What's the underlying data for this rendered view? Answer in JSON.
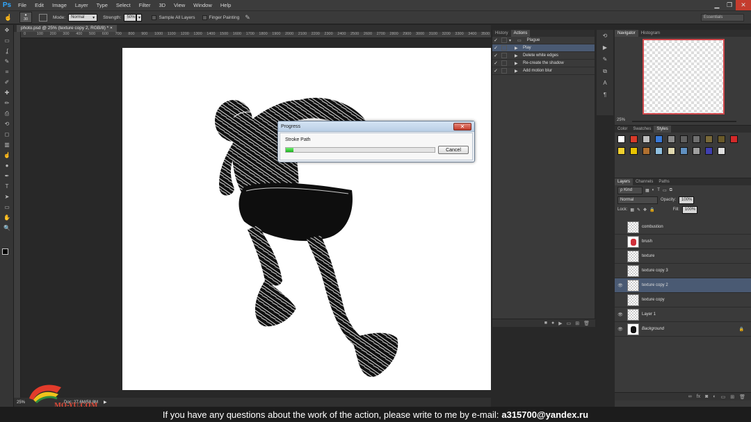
{
  "app": {
    "logo": "Ps",
    "workspace": "Essentials"
  },
  "menu": [
    "File",
    "Edit",
    "Image",
    "Layer",
    "Type",
    "Select",
    "Filter",
    "3D",
    "View",
    "Window",
    "Help"
  ],
  "options": {
    "brush_size": "30",
    "mode_label": "Mode:",
    "mode_value": "Normal",
    "strength_label": "Strength:",
    "strength_value": "50%",
    "sample_all_layers": "Sample All Layers",
    "finger_painting": "Finger Painting"
  },
  "document": {
    "tab_title": "photo.psd @ 25% (texture copy 2, RGB/8) *",
    "ruler_ticks": [
      "0",
      "100",
      "200",
      "300",
      "400",
      "500",
      "600",
      "700",
      "800",
      "900",
      "1000",
      "1100",
      "1200",
      "1300",
      "1400",
      "1500",
      "1600",
      "1700",
      "1800",
      "1900",
      "2000",
      "2100",
      "2200",
      "2300",
      "2400",
      "2500",
      "2600",
      "2700",
      "2800",
      "2900",
      "3000",
      "3100",
      "3200",
      "3300",
      "3400",
      "3500",
      "3600"
    ]
  },
  "status": {
    "zoom": "25%",
    "doc_size": "Doc: 27.6M/58.8M"
  },
  "progress_dialog": {
    "title": "Progress",
    "message": "Stroke Path",
    "progress": 0.05,
    "cancel_label": "Cancel"
  },
  "actions_panel": {
    "tabs": [
      "History",
      "Actions"
    ],
    "rows": [
      {
        "label": "Plague",
        "checked": true,
        "folder": true,
        "selected": false
      },
      {
        "label": "Play",
        "checked": true,
        "folder": false,
        "selected": true
      },
      {
        "label": "Delete white edges",
        "checked": true,
        "folder": false,
        "selected": false
      },
      {
        "label": "Re-create the shadow",
        "checked": true,
        "folder": false,
        "selected": false
      },
      {
        "label": "Add motion blur",
        "checked": true,
        "folder": false,
        "selected": false
      }
    ]
  },
  "navigator": {
    "tabs": [
      "Navigator",
      "Histogram"
    ],
    "zoom": "25%"
  },
  "styles_panel": {
    "tabs": [
      "Color",
      "Swatches",
      "Styles"
    ]
  },
  "layers_panel": {
    "tabs": [
      "Layers",
      "Channels",
      "Paths"
    ],
    "kind_label": "ρ Kind",
    "blend_mode": "Normal",
    "opacity_label": "Opacity:",
    "opacity_value": "100%",
    "lock_label": "Lock:",
    "fill_label": "Fill:",
    "fill_value": "100%",
    "layers": [
      {
        "name": "combustion",
        "visible": false,
        "selected": false
      },
      {
        "name": "brush",
        "visible": false,
        "selected": false
      },
      {
        "name": "texture",
        "visible": false,
        "selected": false
      },
      {
        "name": "texture copy 3",
        "visible": false,
        "selected": false
      },
      {
        "name": "texture copy 2",
        "visible": true,
        "selected": true
      },
      {
        "name": "texture copy",
        "visible": false,
        "selected": false
      },
      {
        "name": "Layer 1",
        "visible": true,
        "selected": false
      },
      {
        "name": "Background",
        "visible": true,
        "selected": false,
        "locked": true
      }
    ]
  },
  "caption": {
    "text": "If you have any questions about the work of the action, please write to me by e-mail:",
    "email": "a315700@yandex.ru"
  },
  "watermark": {
    "text": "MO-YU.COM"
  },
  "colors": {
    "accent_selection": "#4a5a73",
    "progress_green": "#1eb11e",
    "close_red": "#c23a2a",
    "nav_frame": "#d0474b"
  }
}
